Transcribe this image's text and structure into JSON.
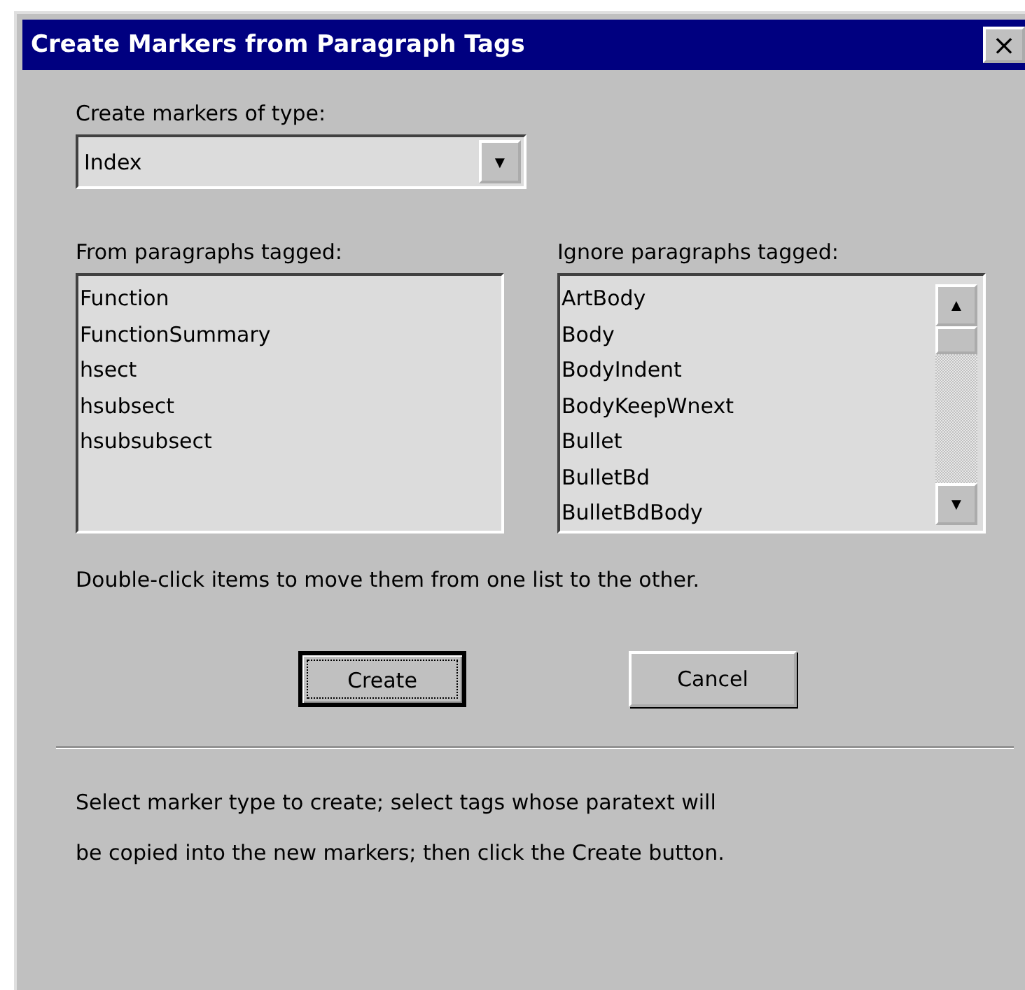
{
  "window": {
    "title": "Create Markers from Paragraph Tags",
    "close_button": "×"
  },
  "marker_type": {
    "label": "Create markers of type:",
    "value": "Index",
    "arrow": "▼"
  },
  "from_list": {
    "label": "From paragraphs tagged:",
    "items": [
      "Function",
      "FunctionSummary",
      "hsect",
      "hsubsect",
      "hsubsubsect"
    ]
  },
  "ignore_list": {
    "label": "Ignore paragraphs tagged:",
    "items": [
      "ArtBody",
      "Body",
      "BodyIndent",
      "BodyKeepWnext",
      "Bullet",
      "BulletBd",
      "BulletBdBody"
    ],
    "scroll_up": "▲",
    "scroll_down": "▼"
  },
  "hint": "Double-click items to move them from one list to the other.",
  "buttons": [
    {
      "label": "Create",
      "default": true,
      "focused": true
    },
    {
      "label": "Cancel",
      "default": false,
      "focused": false
    }
  ],
  "instructions": [
    "Select marker type to create; select tags whose paratext will",
    "be copied into the new markers; then click the Create button."
  ]
}
